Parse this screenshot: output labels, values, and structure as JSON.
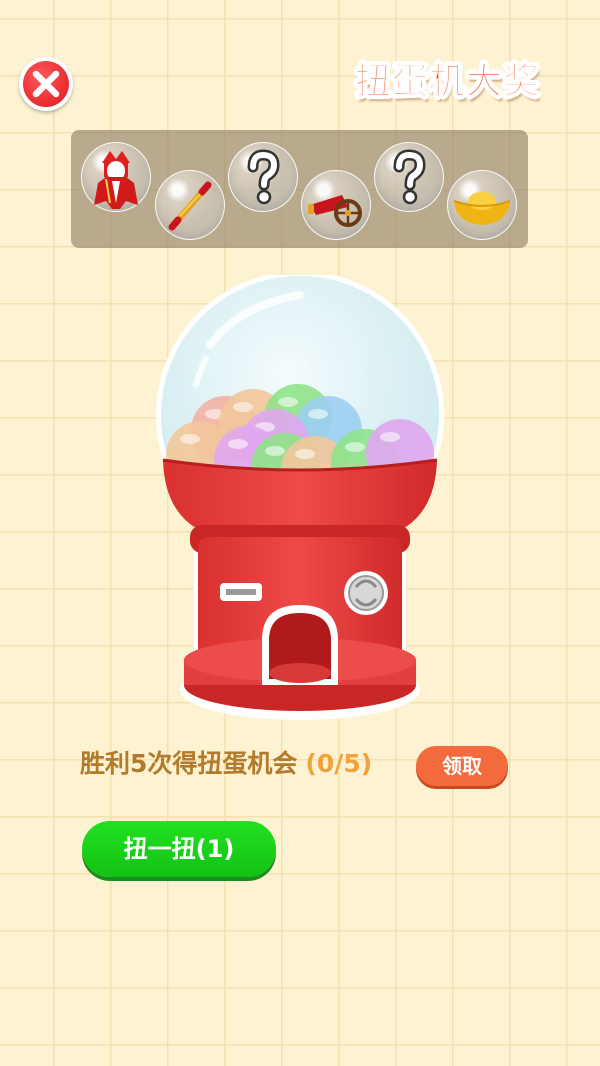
{
  "header": {
    "title": "扭蛋机大奖",
    "close_icon": "close-icon"
  },
  "prizes": [
    {
      "name": "red-warrior-hood-costume-icon"
    },
    {
      "name": "golden-staff-icon"
    },
    {
      "name": "question-mark-icon"
    },
    {
      "name": "red-cannon-icon"
    },
    {
      "name": "question-mark-icon"
    },
    {
      "name": "gold-ingot-icon"
    }
  ],
  "machine": {
    "ball_colors": [
      "#f2b2a4",
      "#f2c79a",
      "#8fe38a",
      "#9ccff2",
      "#e0a6f0",
      "#f2c79a",
      "#e0a6f0",
      "#8fe38a",
      "#f2c79a",
      "#8fe38a",
      "#e0a6f0"
    ],
    "body_color": "#e53b3b"
  },
  "progress": {
    "label": "胜利5次得扭蛋机会",
    "count": "(0/5)",
    "claim_label": "领取"
  },
  "spin": {
    "label": "扭一扭(1)"
  },
  "colors": {
    "accent": "#f05a2a",
    "progress_text": "#b27a2a",
    "claim_button": "#f36a3c",
    "spin_button": "#13c213"
  }
}
